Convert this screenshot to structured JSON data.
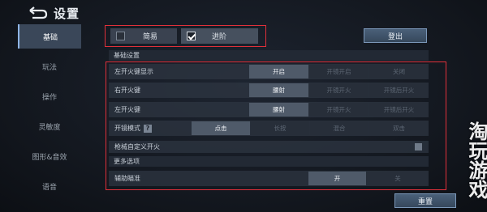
{
  "header": {
    "title": "设置"
  },
  "sidebar": {
    "items": [
      {
        "label": "基础"
      },
      {
        "label": "玩法"
      },
      {
        "label": "操作"
      },
      {
        "label": "灵敏度"
      },
      {
        "label": "图形&音效"
      },
      {
        "label": "语音"
      }
    ]
  },
  "mode": {
    "simple_label": "简易",
    "advanced_label": "进阶",
    "selected": "进阶"
  },
  "buttons": {
    "logout": "登出",
    "reset": "重置"
  },
  "basic": {
    "title": "基础设置",
    "rows": [
      {
        "label": "左开火键显示",
        "options": [
          "开启",
          "开镜开启",
          "关闭"
        ]
      },
      {
        "label": "右开火键",
        "options": [
          "腰射",
          "开镜开火",
          "开镜后开火"
        ]
      },
      {
        "label": "左开火键",
        "options": [
          "腰射",
          "开镜开火",
          "开镜后开火"
        ]
      },
      {
        "label": "开镜模式",
        "options": [
          "点击",
          "长按",
          "混合",
          "双击"
        ]
      }
    ],
    "custom_fire": {
      "label": "枪械自定义开火"
    }
  },
  "more": {
    "title": "更多选项",
    "aim_assist": {
      "label": "辅助瞄准",
      "options": [
        "开",
        "关"
      ]
    }
  },
  "watermark": "淘玩游戏"
}
